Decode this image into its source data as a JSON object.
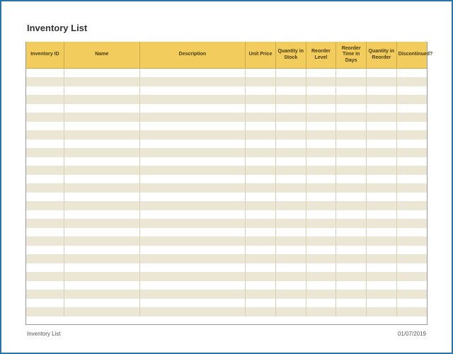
{
  "title": "Inventory List",
  "columns": [
    "Inventory ID",
    "Name",
    "Description",
    "Unit Price",
    "Quantity in Stock",
    "Reorder Level",
    "Reorder Time in Days",
    "Quantity in Reorder",
    "Discontinued?"
  ],
  "rows": [
    [
      "",
      "",
      "",
      "",
      "",
      "",
      "",
      "",
      ""
    ],
    [
      "",
      "",
      "",
      "",
      "",
      "",
      "",
      "",
      ""
    ],
    [
      "",
      "",
      "",
      "",
      "",
      "",
      "",
      "",
      ""
    ],
    [
      "",
      "",
      "",
      "",
      "",
      "",
      "",
      "",
      ""
    ],
    [
      "",
      "",
      "",
      "",
      "",
      "",
      "",
      "",
      ""
    ],
    [
      "",
      "",
      "",
      "",
      "",
      "",
      "",
      "",
      ""
    ],
    [
      "",
      "",
      "",
      "",
      "",
      "",
      "",
      "",
      ""
    ],
    [
      "",
      "",
      "",
      "",
      "",
      "",
      "",
      "",
      ""
    ],
    [
      "",
      "",
      "",
      "",
      "",
      "",
      "",
      "",
      ""
    ],
    [
      "",
      "",
      "",
      "",
      "",
      "",
      "",
      "",
      ""
    ],
    [
      "",
      "",
      "",
      "",
      "",
      "",
      "",
      "",
      ""
    ],
    [
      "",
      "",
      "",
      "",
      "",
      "",
      "",
      "",
      ""
    ],
    [
      "",
      "",
      "",
      "",
      "",
      "",
      "",
      "",
      ""
    ],
    [
      "",
      "",
      "",
      "",
      "",
      "",
      "",
      "",
      ""
    ],
    [
      "",
      "",
      "",
      "",
      "",
      "",
      "",
      "",
      ""
    ],
    [
      "",
      "",
      "",
      "",
      "",
      "",
      "",
      "",
      ""
    ],
    [
      "",
      "",
      "",
      "",
      "",
      "",
      "",
      "",
      ""
    ],
    [
      "",
      "",
      "",
      "",
      "",
      "",
      "",
      "",
      ""
    ],
    [
      "",
      "",
      "",
      "",
      "",
      "",
      "",
      "",
      ""
    ],
    [
      "",
      "",
      "",
      "",
      "",
      "",
      "",
      "",
      ""
    ],
    [
      "",
      "",
      "",
      "",
      "",
      "",
      "",
      "",
      ""
    ],
    [
      "",
      "",
      "",
      "",
      "",
      "",
      "",
      "",
      ""
    ],
    [
      "",
      "",
      "",
      "",
      "",
      "",
      "",
      "",
      ""
    ],
    [
      "",
      "",
      "",
      "",
      "",
      "",
      "",
      "",
      ""
    ],
    [
      "",
      "",
      "",
      "",
      "",
      "",
      "",
      "",
      ""
    ],
    [
      "",
      "",
      "",
      "",
      "",
      "",
      "",
      "",
      ""
    ],
    [
      "",
      "",
      "",
      "",
      "",
      "",
      "",
      "",
      ""
    ],
    [
      "",
      "",
      "",
      "",
      "",
      "",
      "",
      "",
      ""
    ]
  ],
  "footer": {
    "left": "Inventory List",
    "right": "01/07/2019"
  }
}
